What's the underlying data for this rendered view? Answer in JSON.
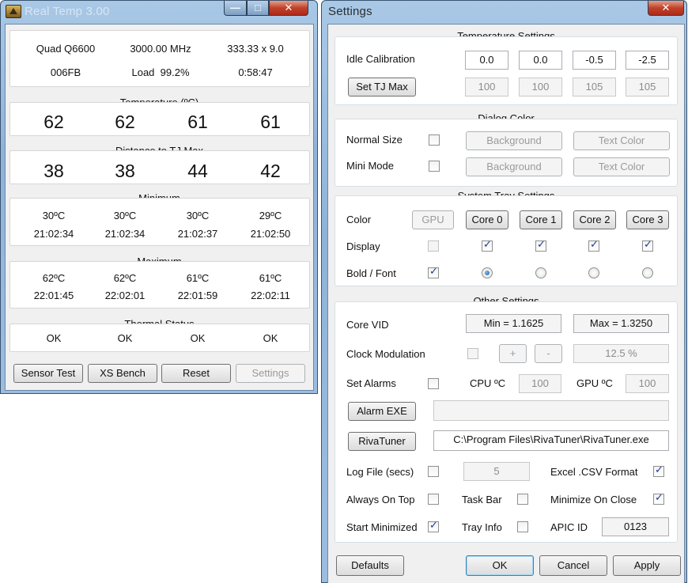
{
  "realtemp": {
    "title": "Real Temp 3.00",
    "caption": {
      "minimize": "—",
      "maximize": "□",
      "close": "✕"
    },
    "cpu": {
      "model": "Quad Q6600",
      "freq": "3000.00 MHz",
      "multiplier": "333.33 x 9.0",
      "vid": "006FB",
      "load_label": "Load",
      "load_value": "99.2%",
      "uptime": "0:58:47"
    },
    "temperature": {
      "title": "Temperature (ºC)",
      "values": [
        "62",
        "62",
        "61",
        "61"
      ]
    },
    "distance": {
      "title": "Distance to TJ Max",
      "values": [
        "38",
        "38",
        "44",
        "42"
      ]
    },
    "minimum": {
      "title": "Minimum",
      "temps": [
        "30ºC",
        "30ºC",
        "30ºC",
        "29ºC"
      ],
      "times": [
        "21:02:34",
        "21:02:34",
        "21:02:37",
        "21:02:50"
      ]
    },
    "maximum": {
      "title": "Maximum",
      "temps": [
        "62ºC",
        "62ºC",
        "61ºC",
        "61ºC"
      ],
      "times": [
        "22:01:45",
        "22:02:01",
        "22:01:59",
        "22:02:11"
      ]
    },
    "thermal": {
      "title": "Thermal Status",
      "values": [
        "OK",
        "OK",
        "OK",
        "OK"
      ]
    },
    "buttons": {
      "sensor_test": "Sensor Test",
      "xs_bench": "XS Bench",
      "reset": "Reset",
      "settings": "Settings"
    }
  },
  "settings": {
    "title": "Settings",
    "caption": {
      "close": "✕"
    },
    "temperature": {
      "title": "Temperature Settings",
      "idle_label": "Idle Calibration",
      "idle_values": [
        "0.0",
        "0.0",
        "-0.5",
        "-2.5"
      ],
      "set_tj_button": "Set TJ Max",
      "tj_values": [
        "100",
        "100",
        "105",
        "105"
      ]
    },
    "dialog_color": {
      "title": "Dialog Color",
      "normal_label": "Normal Size",
      "mini_label": "Mini Mode",
      "background": "Background",
      "text_color": "Text Color"
    },
    "tray": {
      "title": "System Tray Settings",
      "color_label": "Color",
      "display_label": "Display",
      "bold_label": "Bold / Font",
      "gpu": "GPU",
      "cores": [
        "Core 0",
        "Core 1",
        "Core 2",
        "Core 3"
      ]
    },
    "other": {
      "title": "Other Settings",
      "core_vid_label": "Core VID",
      "vid_min": "Min = 1.1625",
      "vid_max": "Max = 1.3250",
      "clock_mod_label": "Clock Modulation",
      "plus": "+",
      "minus": "-",
      "clock_mod_value": "12.5 %",
      "alarms_label": "Set Alarms",
      "cpu_c_label": "CPU ºC",
      "cpu_c_value": "100",
      "gpu_c_label": "GPU ºC",
      "gpu_c_value": "100",
      "alarm_exe_button": "Alarm EXE",
      "alarm_exe_path": "",
      "rivatuner_button": "RivaTuner",
      "rivatuner_path": "C:\\Program Files\\RivaTuner\\RivaTuner.exe",
      "log_file_label": "Log File (secs)",
      "log_file_value": "5",
      "excel_label": "Excel .CSV Format",
      "always_on_top_label": "Always On Top",
      "task_bar_label": "Task Bar",
      "minimize_on_close_label": "Minimize On Close",
      "start_minimized_label": "Start Minimized",
      "tray_info_label": "Tray Info",
      "apic_id_label": "APIC ID",
      "apic_id_value": "0123"
    },
    "buttons": {
      "defaults": "Defaults",
      "ok": "OK",
      "cancel": "Cancel",
      "apply": "Apply"
    }
  }
}
